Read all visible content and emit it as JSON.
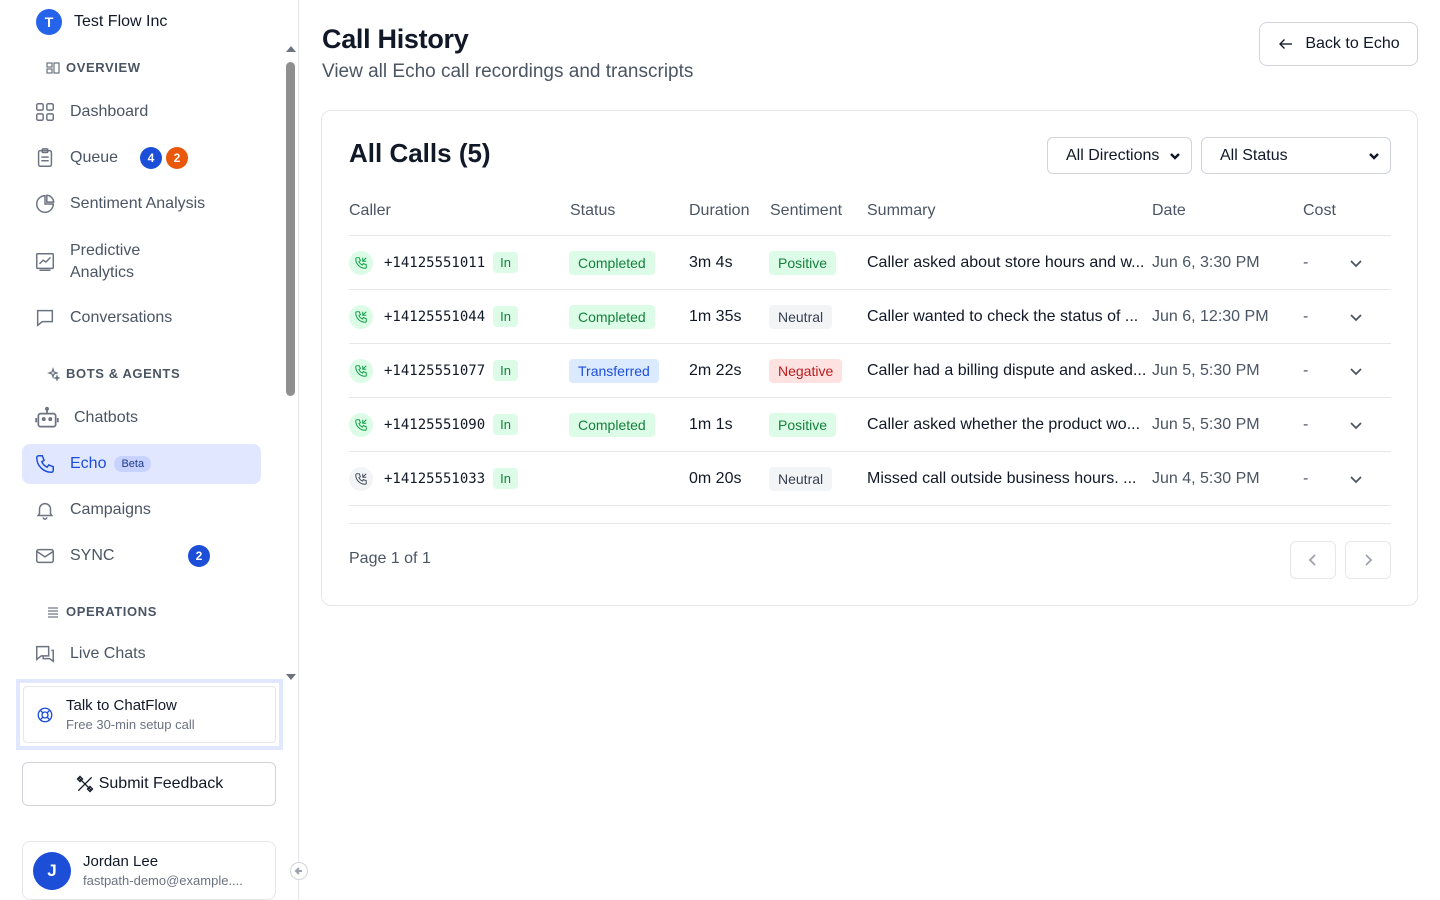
{
  "org": {
    "initial": "T",
    "name": "Test Flow Inc"
  },
  "sidebar": {
    "sections": {
      "overview": "OVERVIEW",
      "bots": "BOTS & AGENTS",
      "operations": "OPERATIONS"
    },
    "items": [
      {
        "label": "Dashboard",
        "icon": "dashboard-icon"
      },
      {
        "label": "Queue",
        "icon": "clipboard-icon",
        "badges": [
          "4",
          "2"
        ]
      },
      {
        "label": "Sentiment Analysis",
        "icon": "pie-chart-icon"
      },
      {
        "label": "Predictive Analytics",
        "icon": "trend-chart-icon"
      },
      {
        "label": "Conversations",
        "icon": "chat-icon"
      },
      {
        "label": "Chatbots",
        "icon": "bot-icon"
      },
      {
        "label": "Echo",
        "icon": "phone-icon",
        "tag": "Beta",
        "active": true
      },
      {
        "label": "Campaigns",
        "icon": "bell-icon"
      },
      {
        "label": "SYNC",
        "icon": "mail-icon",
        "badges": [
          "2"
        ]
      },
      {
        "label": "Live Chats",
        "icon": "chats-icon"
      }
    ],
    "talk": {
      "title": "Talk to ChatFlow",
      "subtitle": "Free 30-min setup call"
    },
    "feedback_label": "Submit Feedback",
    "user": {
      "initial": "J",
      "name": "Jordan Lee",
      "email": "fastpath-demo@example...."
    }
  },
  "header": {
    "title": "Call History",
    "subtitle": "View all Echo call recordings and transcripts",
    "back_label": "Back to Echo"
  },
  "card": {
    "title": "All Calls (5)",
    "direction_filter": "All Directions",
    "status_filter": "All Status",
    "columns": [
      "Caller",
      "Status",
      "Duration",
      "Sentiment",
      "Summary",
      "Date",
      "Cost"
    ],
    "rows": [
      {
        "caller": "+14125551011",
        "direction": "In",
        "status": "Completed",
        "duration": "3m 4s",
        "sentiment": "Positive",
        "summary": "Caller asked about store hours and w...",
        "date": "Jun 6, 3:30 PM",
        "cost": "-"
      },
      {
        "caller": "+14125551044",
        "direction": "In",
        "status": "Completed",
        "duration": "1m 35s",
        "sentiment": "Neutral",
        "summary": "Caller wanted to check the status of ...",
        "date": "Jun 6, 12:30 PM",
        "cost": "-"
      },
      {
        "caller": "+14125551077",
        "direction": "In",
        "status": "Transferred",
        "duration": "2m 22s",
        "sentiment": "Negative",
        "summary": "Caller had a billing dispute and asked...",
        "date": "Jun 5, 5:30 PM",
        "cost": "-"
      },
      {
        "caller": "+14125551090",
        "direction": "In",
        "status": "Completed",
        "duration": "1m 1s",
        "sentiment": "Positive",
        "summary": "Caller asked whether the product wo...",
        "date": "Jun 5, 5:30 PM",
        "cost": "-"
      },
      {
        "caller": "+14125551033",
        "direction": "In",
        "status": "",
        "duration": "0m 20s",
        "sentiment": "Neutral",
        "summary": "Missed call outside business hours. ...",
        "date": "Jun 4, 5:30 PM",
        "cost": "-"
      }
    ],
    "page_info": "Page 1 of 1"
  }
}
